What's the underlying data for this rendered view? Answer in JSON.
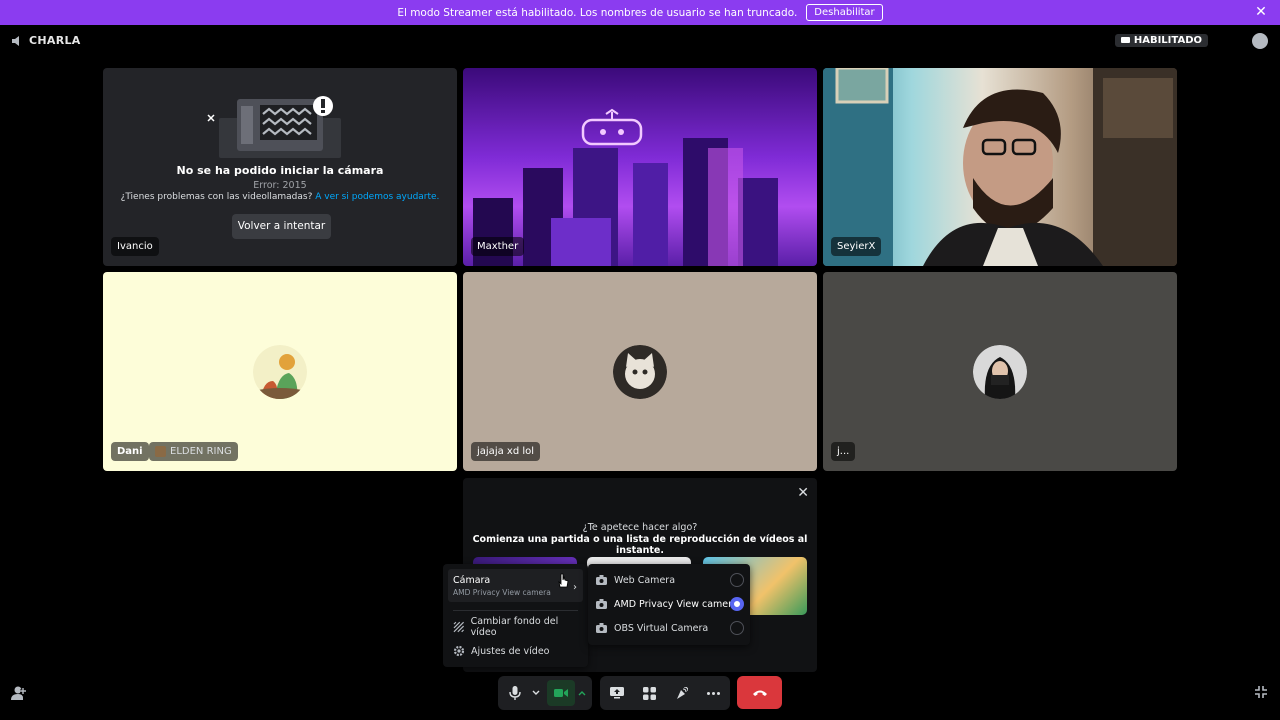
{
  "banner": {
    "message": "El modo Streamer está habilitado. Los nombres de usuario se han truncado.",
    "button_label": "Deshabilitar"
  },
  "app": {
    "title": "CHARLA"
  },
  "status_badge": "HABILITADO",
  "tiles": [
    {
      "name": "Ivancio",
      "error_title": "No se ha podido iniciar la cámara",
      "error_code": "Error: 2015",
      "help_text": "¿Tienes problemas con las videollamadas?",
      "help_link": "A ver si podemos ayudarte.",
      "retry_label": "Volver a intentar"
    },
    {
      "name": "Maxther"
    },
    {
      "name": "SeyierX"
    },
    {
      "name": "Dani",
      "activity": "ELDEN RING"
    },
    {
      "name": "jajaja xd lol"
    },
    {
      "name": "j..."
    }
  ],
  "activity_panel": {
    "title": "¿Te apetece hacer algo?",
    "subtitle": "Comienza una partida o una lista de reproducción de vídeos al instante."
  },
  "video_menu": {
    "camera_label": "Cámara",
    "camera_selected": "AMD Privacy View camera",
    "change_background": "Cambiar fondo del vídeo",
    "video_settings": "Ajustes de vídeo"
  },
  "camera_options": [
    {
      "label": "Web Camera",
      "selected": false
    },
    {
      "label": "AMD Privacy View camera",
      "selected": true
    },
    {
      "label": "OBS Virtual Camera",
      "selected": false
    }
  ],
  "colors": {
    "banner": "#8b3cf0",
    "accent": "#5865f2",
    "end_call": "#da373c",
    "link": "#00a8fc"
  }
}
